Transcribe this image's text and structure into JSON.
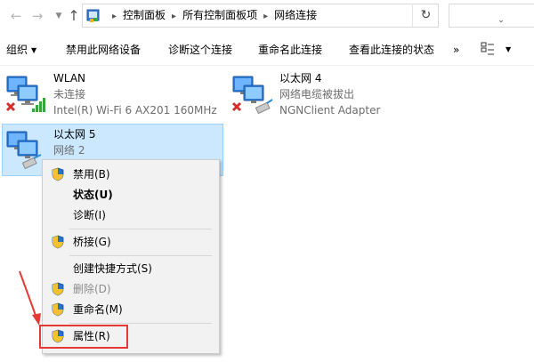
{
  "address_bar": {
    "crumbs": [
      "控制面板",
      "所有控制面板项",
      "网络连接"
    ]
  },
  "command_bar": {
    "organize": "组织",
    "disable_device": "禁用此网络设备",
    "diagnose": "诊断这个连接",
    "rename": "重命名此连接",
    "view_status": "查看此连接的状态",
    "more": "»"
  },
  "connections": [
    {
      "name": "WLAN",
      "status": "未连接",
      "adapter": "Intel(R) Wi-Fi 6 AX201 160MHz"
    },
    {
      "name": "以太网 4",
      "status": "网络电缆被拔出",
      "adapter": "NGNClient Adapter"
    },
    {
      "name": "以太网 5",
      "status": "网络 2"
    }
  ],
  "context_menu": {
    "items": [
      {
        "label": "禁用(B)",
        "shield": true,
        "bold": false,
        "disabled": false
      },
      {
        "label": "状态(U)",
        "shield": false,
        "bold": true,
        "disabled": false
      },
      {
        "label": "诊断(I)",
        "shield": false,
        "bold": false,
        "disabled": false
      },
      {
        "label": "桥接(G)",
        "shield": true,
        "bold": false,
        "disabled": false
      },
      {
        "label": "创建快捷方式(S)",
        "shield": false,
        "bold": false,
        "disabled": false
      },
      {
        "label": "删除(D)",
        "shield": true,
        "bold": false,
        "disabled": true
      },
      {
        "label": "重命名(M)",
        "shield": true,
        "bold": false,
        "disabled": false
      },
      {
        "label": "属性(R)",
        "shield": true,
        "bold": false,
        "disabled": false
      }
    ]
  },
  "colors": {
    "selection_bg": "#cce8ff",
    "selection_border": "#99d1ff",
    "annotation_red": "#e53935"
  }
}
